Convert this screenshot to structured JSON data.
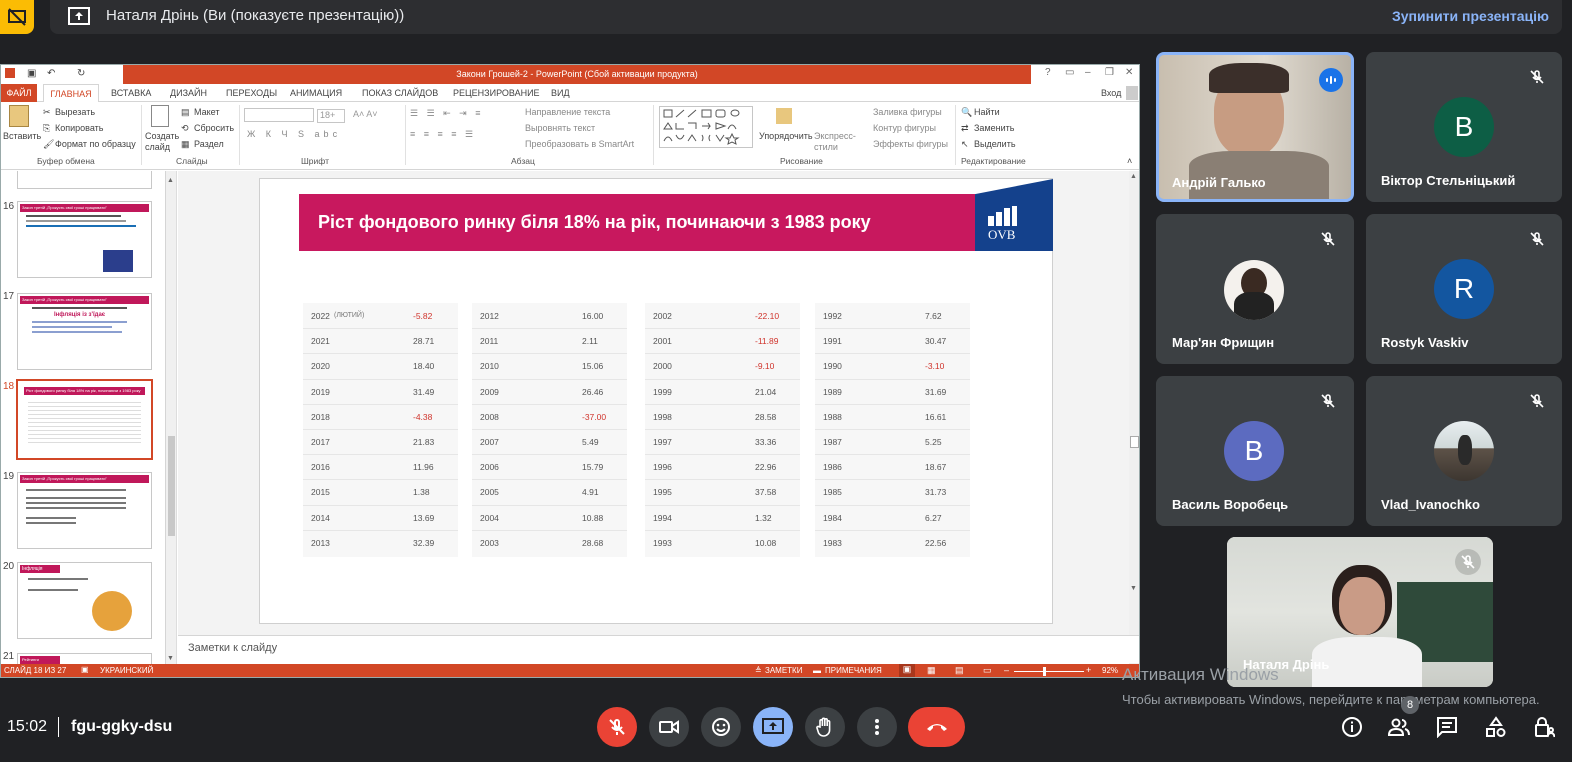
{
  "topbar": {
    "presenter_text": "Наталя Дрінь (Ви (показуєте презентацію))",
    "stop_label": "Зупинити презентацію"
  },
  "ppt": {
    "window_title": "Закони Грошей-2 - PowerPoint (Сбой активации продукта)",
    "signin": "Вход",
    "tabs": [
      "ФАЙЛ",
      "ГЛАВНАЯ",
      "ВСТАВКА",
      "ДИЗАЙН",
      "ПЕРЕХОДЫ",
      "АНИМАЦИЯ",
      "ПОКАЗ СЛАЙДОВ",
      "РЕЦЕНЗИРОВАНИЕ",
      "ВИД"
    ],
    "ribbon": {
      "paste": "Вставить",
      "cut": "Вырезать",
      "copy": "Копировать",
      "format_painter": "Формат по образцу",
      "clipboard_group": "Буфер обмена",
      "new_slide": "Создать слайд",
      "layout": "Макет",
      "reset": "Сбросить",
      "section": "Раздел",
      "slides_group": "Слайды",
      "font_size": "18+",
      "font_group": "Шрифт",
      "text_direction": "Направление текста",
      "align_text": "Выровнять текст",
      "smartart": "Преобразовать в SmartArt",
      "paragraph_group": "Абзац",
      "arrange": "Упорядочить",
      "quick_styles": "Экспресс-стили",
      "shape_fill": "Заливка фигуры",
      "shape_outline": "Контур фигуры",
      "shape_effects": "Эффекты фигуры",
      "drawing_group": "Рисование",
      "find": "Найти",
      "replace": "Заменить",
      "select": "Выделить",
      "editing_group": "Редактирование"
    },
    "thumbs": [
      "16",
      "17",
      "18",
      "19",
      "20",
      "21"
    ],
    "thumb_titles": [
      "Закон третій „Прокусть свої гроші працювати\"",
      "Закон третій „Прокусть свої гроші працювати\"",
      "Ріст фондового ринку біля 18% на рік, починаючи з 1983 року",
      "Закон третій „Прокусть свої гроші працювати\"",
      "Інфляція",
      "Рейтинги"
    ],
    "thumb17_inflation": "Інфляція із з'їдає",
    "slide": {
      "title": "Ріст фондового ринку біля 18%  на рік, починаючи з 1983 року",
      "logo": "OVB",
      "columns": [
        [
          [
            "2022",
            "-5.82",
            "(ЛЮТИЙ)"
          ],
          [
            "2021",
            "28.71"
          ],
          [
            "2020",
            "18.40"
          ],
          [
            "2019",
            "31.49"
          ],
          [
            "2018",
            "-4.38"
          ],
          [
            "2017",
            "21.83"
          ],
          [
            "2016",
            "11.96"
          ],
          [
            "2015",
            "1.38"
          ],
          [
            "2014",
            "13.69"
          ],
          [
            "2013",
            "32.39"
          ]
        ],
        [
          [
            "2012",
            "16.00"
          ],
          [
            "2011",
            "2.11"
          ],
          [
            "2010",
            "15.06"
          ],
          [
            "2009",
            "26.46"
          ],
          [
            "2008",
            "-37.00"
          ],
          [
            "2007",
            "5.49"
          ],
          [
            "2006",
            "15.79"
          ],
          [
            "2005",
            "4.91"
          ],
          [
            "2004",
            "10.88"
          ],
          [
            "2003",
            "28.68"
          ]
        ],
        [
          [
            "2002",
            "-22.10"
          ],
          [
            "2001",
            "-11.89"
          ],
          [
            "2000",
            "-9.10"
          ],
          [
            "1999",
            "21.04"
          ],
          [
            "1998",
            "28.58"
          ],
          [
            "1997",
            "33.36"
          ],
          [
            "1996",
            "22.96"
          ],
          [
            "1995",
            "37.58"
          ],
          [
            "1994",
            "1.32"
          ],
          [
            "1993",
            "10.08"
          ]
        ],
        [
          [
            "1992",
            "7.62"
          ],
          [
            "1991",
            "30.47"
          ],
          [
            "1990",
            "-3.10"
          ],
          [
            "1989",
            "31.69"
          ],
          [
            "1988",
            "16.61"
          ],
          [
            "1987",
            "5.25"
          ],
          [
            "1986",
            "18.67"
          ],
          [
            "1985",
            "31.73"
          ],
          [
            "1984",
            "6.27"
          ],
          [
            "1983",
            "22.56"
          ]
        ]
      ]
    },
    "notes_placeholder": "Заметки к слайду",
    "status": {
      "slide_info": "СЛАЙД 18 ИЗ 27",
      "language": "УКРАИНСКИЙ",
      "notes": "ЗАМЕТКИ",
      "comments": "ПРИМЕЧАНИЯ",
      "zoom": "92%"
    }
  },
  "participants": [
    {
      "name": "Андрій Галько",
      "type": "video"
    },
    {
      "name": "Віктор Стельніцький",
      "initial": "B",
      "color": "#0d5e45"
    },
    {
      "name": "Мар'ян Фрищин",
      "type": "photo"
    },
    {
      "name": "Rostyk Vaskiv",
      "initial": "R",
      "color": "#1356a0"
    },
    {
      "name": "Василь Воробець",
      "initial": "B",
      "color": "#5c6bc0"
    },
    {
      "name": "Vlad_Ivanochko",
      "type": "photo"
    },
    {
      "name": "Наталя Дрінь",
      "type": "video"
    }
  ],
  "bottombar": {
    "time": "15:02",
    "meeting_code": "fgu-ggky-dsu",
    "participant_count": "8"
  },
  "watermark": {
    "title": "Активация Windows",
    "text": "Чтобы активировать Windows, перейдите к параметрам компьютера."
  },
  "colors": {
    "accent": "#d24726",
    "slide_banner": "#c8185e",
    "ovb_blue": "#14418c",
    "end_call": "#ea4335",
    "present_active": "#8ab4f8"
  }
}
